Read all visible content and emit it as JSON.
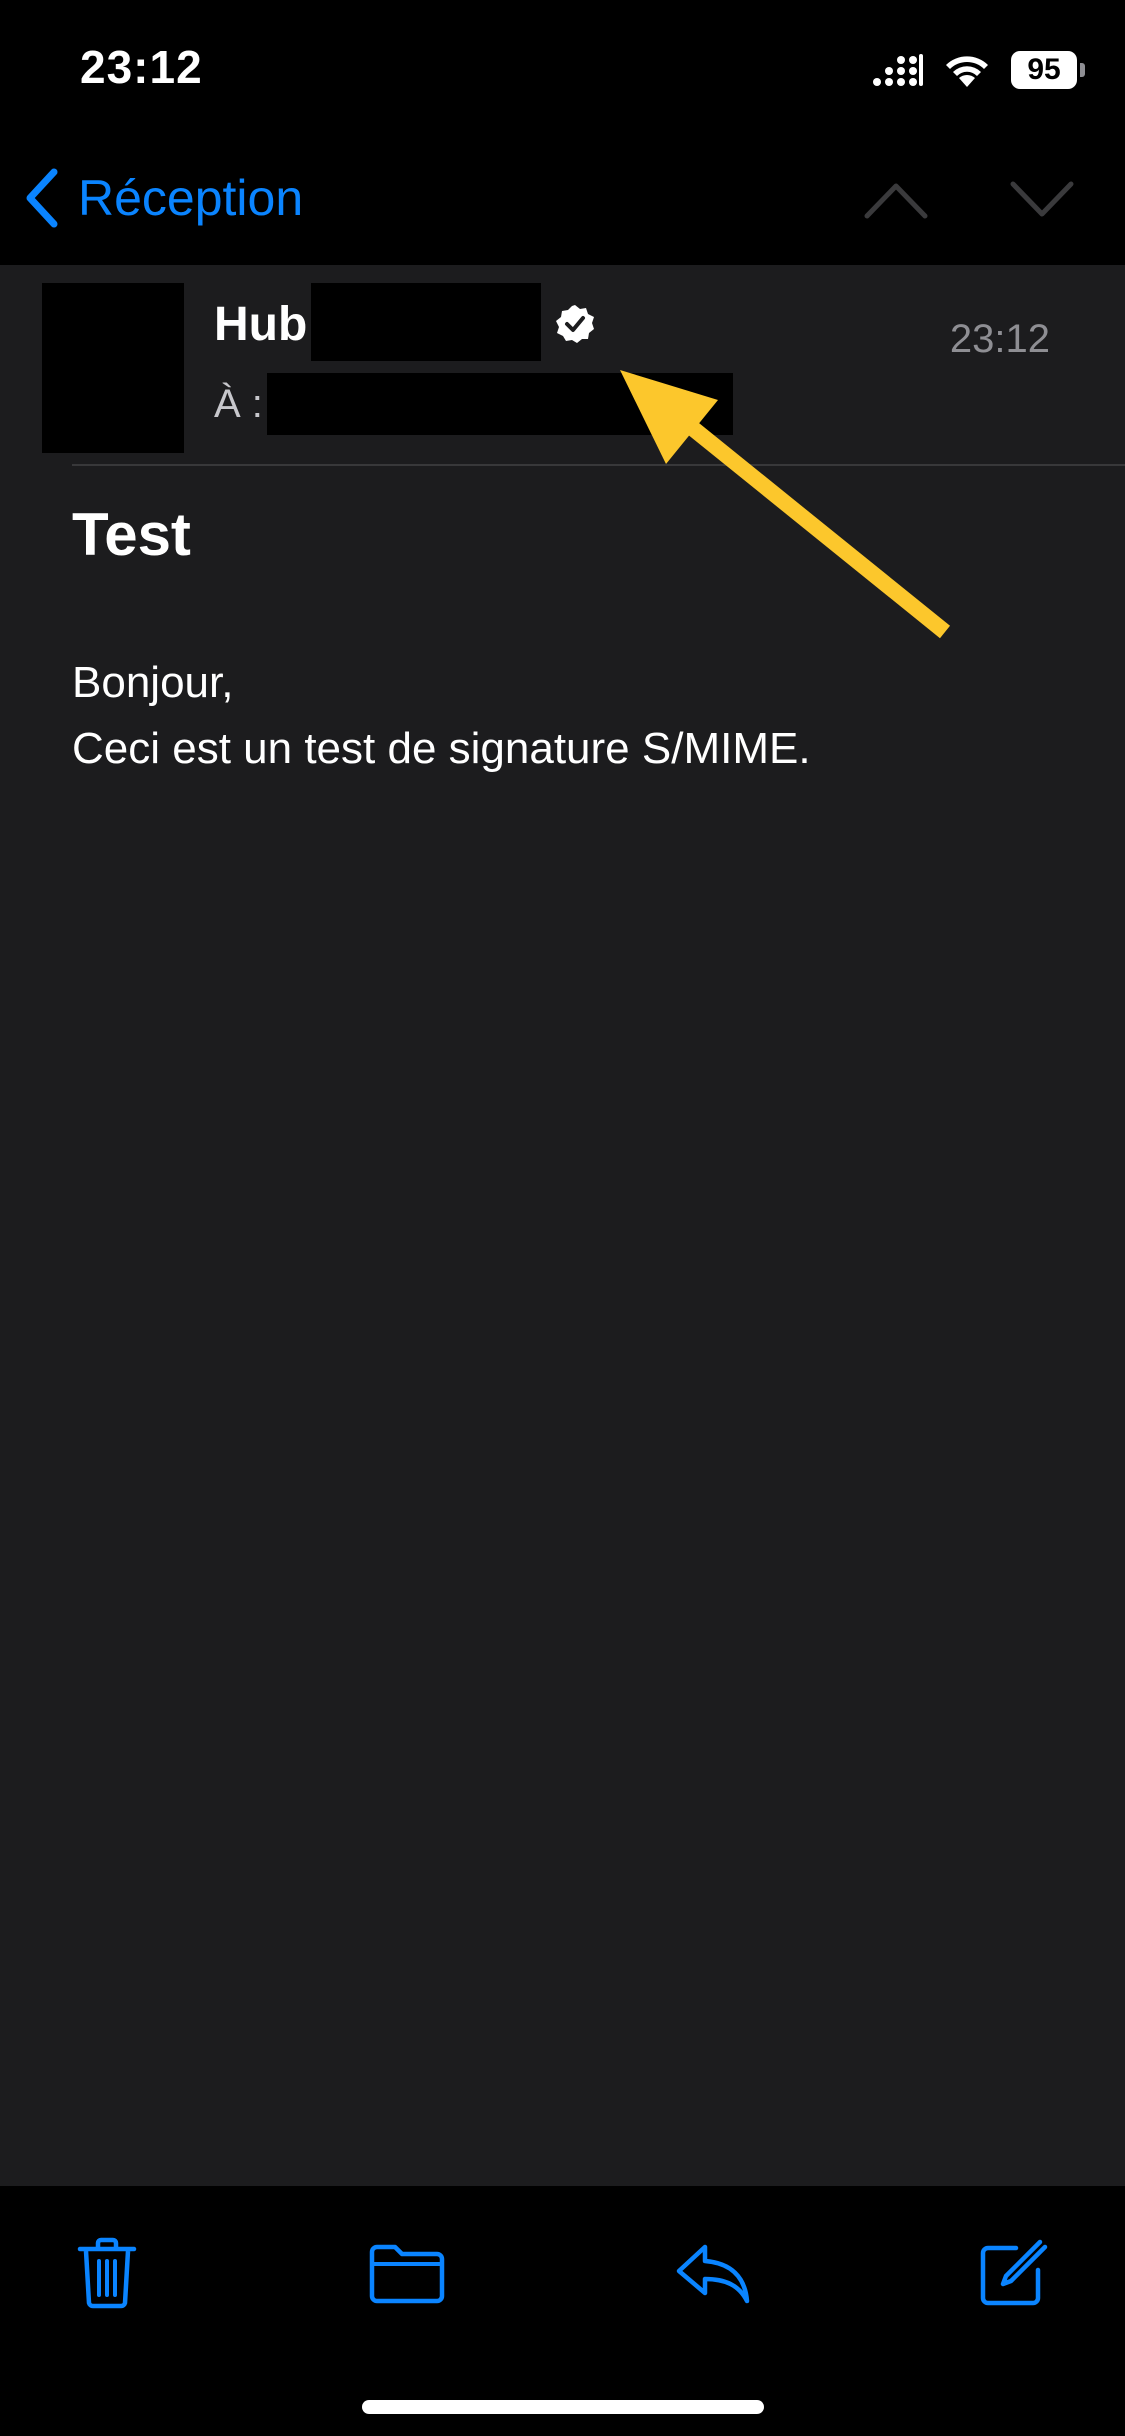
{
  "status_bar": {
    "time": "23:12",
    "battery": "95",
    "icons": [
      "cellular-signal-icon",
      "wifi-icon",
      "battery-icon"
    ]
  },
  "nav": {
    "back_label": "Réception",
    "icons": [
      "chevron-left-icon",
      "chevron-up-icon",
      "chevron-down-icon"
    ]
  },
  "mail": {
    "sender_visible": "Hub",
    "recipient_label": "À :",
    "time": "23:12",
    "subject": "Test",
    "body_lines": [
      "Bonjour,",
      "Ceci est un test de signature S/MIME."
    ],
    "icons": [
      "verified-badge-icon",
      "annotation-arrow-icon"
    ]
  },
  "toolbar": {
    "icons": [
      "trash-icon",
      "folder-icon",
      "reply-icon",
      "compose-icon"
    ]
  },
  "colors": {
    "accent": "#0a84ff",
    "background": "#1c1c1e",
    "bars": "#000000",
    "secondary_text": "#8e8e93",
    "annotation": "#fcc72c",
    "disabled": "#3a3a3c"
  }
}
